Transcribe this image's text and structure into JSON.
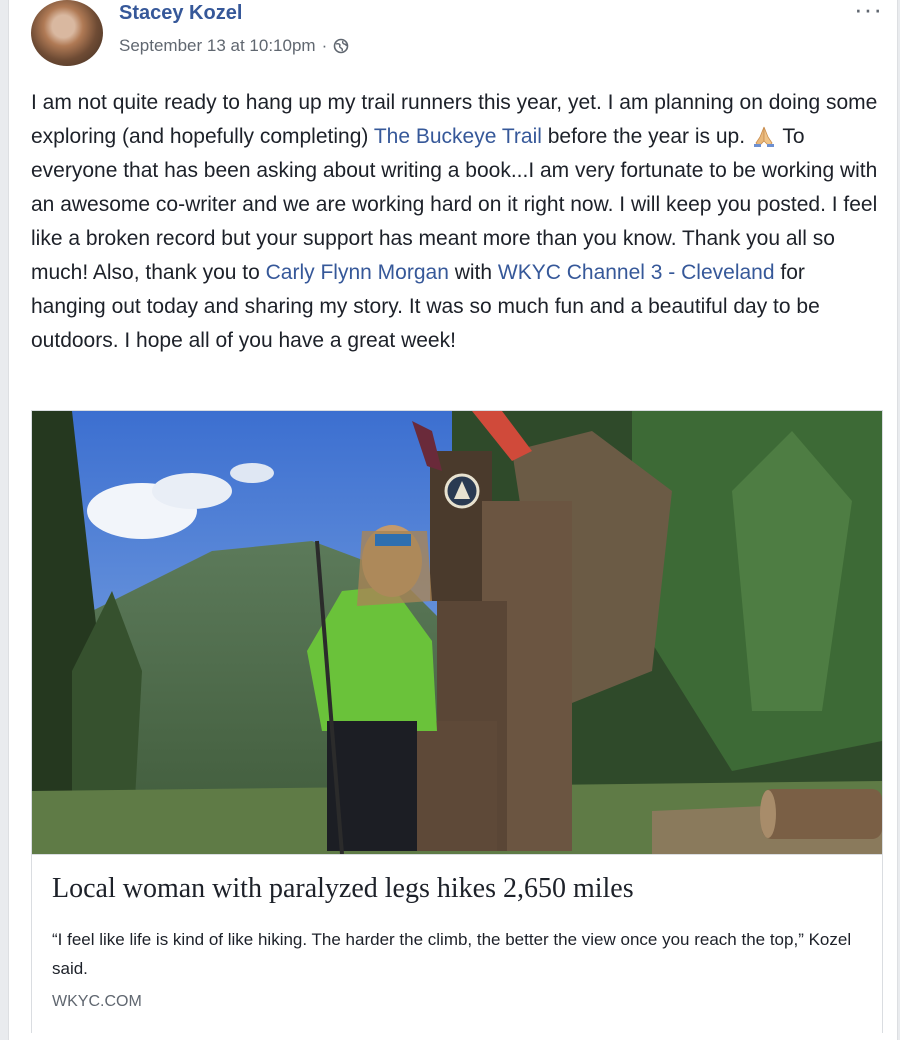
{
  "post": {
    "author": "Stacey Kozel",
    "timestamp": "September 13 at 10:10pm",
    "separator": "·",
    "privacy_icon": "globe-icon",
    "more_label": "···",
    "text": {
      "p1": "I am not quite ready to hang up my trail runners this year, yet. I am planning on doing some exploring (and hopefully completing) ",
      "link1": "The Buckeye Trail",
      "p2": " before the year is up. ",
      "emoji": "folded-hands-icon",
      "p3": " To everyone that has been asking about writing a book...I am very fortunate to be working with an awesome co-writer and we are working hard on it right now. I will keep you posted. I feel like a broken record but your support has meant more than you know. Thank you all so much! Also, thank you to ",
      "link2": "Carly Flynn Morgan",
      "p4": " with ",
      "link3": "WKYC Channel 3 - Cleveland",
      "p5": " for hanging out today and sharing my story. It was so much fun and a beautiful day to be outdoors. I hope all of you have a great week!"
    }
  },
  "link_card": {
    "title": "Local woman with paralyzed legs hikes 2,650 miles",
    "description": "“I feel like life is kind of like hiking. The harder the climb, the better the view once you reach the top,” Kozel said.",
    "domain": "WKYC.COM"
  },
  "colors": {
    "link": "#365899",
    "text": "#1d2129",
    "meta": "#606770",
    "background": "#e9ebee"
  }
}
